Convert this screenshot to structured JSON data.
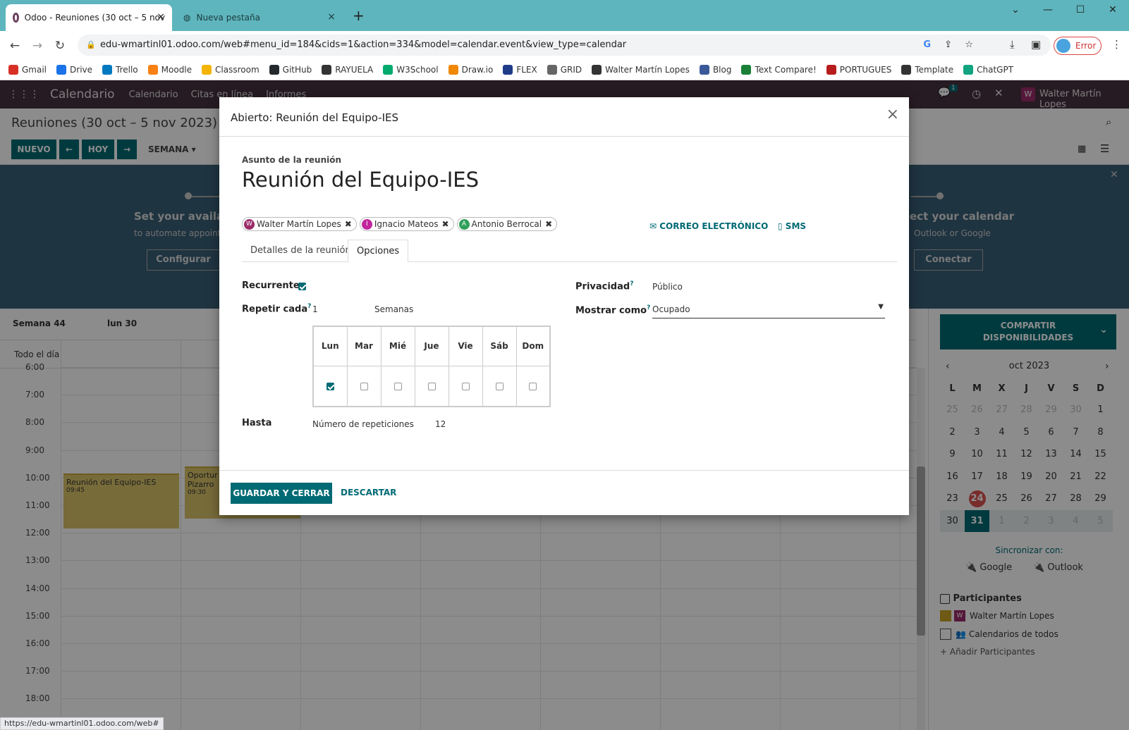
{
  "browser": {
    "tabs": [
      {
        "title": "Odoo - Reuniones (30 oct – 5 nov",
        "close": "×"
      },
      {
        "title": "Nueva pestaña",
        "close": "×"
      }
    ],
    "new_tab": "+",
    "url": "edu-wmartinl01.odoo.com/web#menu_id=184&cids=1&action=334&model=calendar.event&view_type=calendar",
    "profile_label": "Error",
    "bookmarks": [
      "Gmail",
      "Drive",
      "Trello",
      "Moodle",
      "Classroom",
      "GitHub",
      "RAYUELA",
      "W3School",
      "Draw.io",
      "FLEX",
      "GRID",
      "Walter Martín Lopes",
      "Blog",
      "Text Compare!",
      "PORTUGUES",
      "Template",
      "ChatGPT"
    ],
    "status_url": "https://edu-wmartinl01.odoo.com/web#"
  },
  "odoo": {
    "app": "Calendario",
    "menu": [
      "Calendario",
      "Citas en línea",
      "Informes"
    ],
    "chat_count": "1",
    "user": "Walter Martín Lopes",
    "user_initial": "W",
    "page_title": "Reuniones (30 oct – 5 nov 2023)",
    "buttons": {
      "new": "NUEVO",
      "today": "HOY",
      "week": "SEMANA"
    },
    "banner": {
      "left_title": "Set your availabi",
      "left_sub": "to automate appoint",
      "left_btn": "Configurar",
      "right_title": "ect your calendar",
      "right_sub": "Outlook or Google",
      "right_btn": "Conectar"
    },
    "calendar": {
      "week": "Semana 44",
      "day": "lun 30",
      "allday": "Todo el día",
      "hours": [
        "6:00",
        "7:00",
        "8:00",
        "9:00",
        "10:00",
        "11:00",
        "12:00",
        "13:00",
        "14:00",
        "15:00",
        "16:00",
        "17:00",
        "18:00"
      ],
      "events": [
        {
          "title": "Reunión del Equipo-IES",
          "time": "09:45"
        },
        {
          "title": "Oportur Pizarro",
          "time": "09:30"
        }
      ]
    },
    "side": {
      "share": "COMPARTIR DISPONIBILIDADES",
      "month": "oct 2023",
      "weekdays": [
        "L",
        "M",
        "X",
        "J",
        "V",
        "S",
        "D"
      ],
      "weeks": [
        [
          "25",
          "26",
          "27",
          "28",
          "29",
          "30",
          "1"
        ],
        [
          "2",
          "3",
          "4",
          "5",
          "6",
          "7",
          "8"
        ],
        [
          "9",
          "10",
          "11",
          "12",
          "13",
          "14",
          "15"
        ],
        [
          "16",
          "17",
          "18",
          "19",
          "20",
          "21",
          "22"
        ],
        [
          "23",
          "24",
          "25",
          "26",
          "27",
          "28",
          "29"
        ],
        [
          "30",
          "31",
          "1",
          "2",
          "3",
          "4",
          "5"
        ]
      ],
      "sync": "Sincronizar con:",
      "google": "Google",
      "outlook": "Outlook",
      "participants": "Participantes",
      "p1": "Walter Martín Lopes",
      "p2": "Calendarios de todos",
      "add": "+ Añadir Participantes"
    }
  },
  "modal": {
    "title": "Abierto: Reunión del Equipo-IES",
    "close": "×",
    "subject_label": "Asunto de la reunión",
    "subject": "Reunión del Equipo-IES",
    "attendees": [
      {
        "name": "Walter Martín Lopes",
        "initial": "W",
        "color": "#9b2c6a"
      },
      {
        "name": "Ignacio Mateos",
        "initial": "I",
        "color": "#c0269d"
      },
      {
        "name": "Antonio Berrocal",
        "initial": "A",
        "color": "#2fa05a"
      }
    ],
    "email_btn": "CORREO ELECTRÓNICO",
    "sms_btn": "SMS",
    "tabs": [
      "Detalles de la reunión",
      "Opciones"
    ],
    "recurrent_label": "Recurrente",
    "repeat_label": "Repetir cada",
    "repeat_value": "1",
    "repeat_unit": "Semanas",
    "days": [
      "Lun",
      "Mar",
      "Mié",
      "Jue",
      "Vie",
      "Sáb",
      "Dom"
    ],
    "until_label": "Hasta",
    "until_type": "Número de repeticiones",
    "until_count": "12",
    "privacy_label": "Privacidad",
    "privacy_value": "Público",
    "showas_label": "Mostrar como",
    "showas_value": "Ocupado",
    "help": "?",
    "save": "GUARDAR Y CERRAR",
    "discard": "DESCARTAR"
  },
  "colors": {
    "accent": "#016a74",
    "navbar": "#46323e",
    "today": "#d9534f"
  }
}
